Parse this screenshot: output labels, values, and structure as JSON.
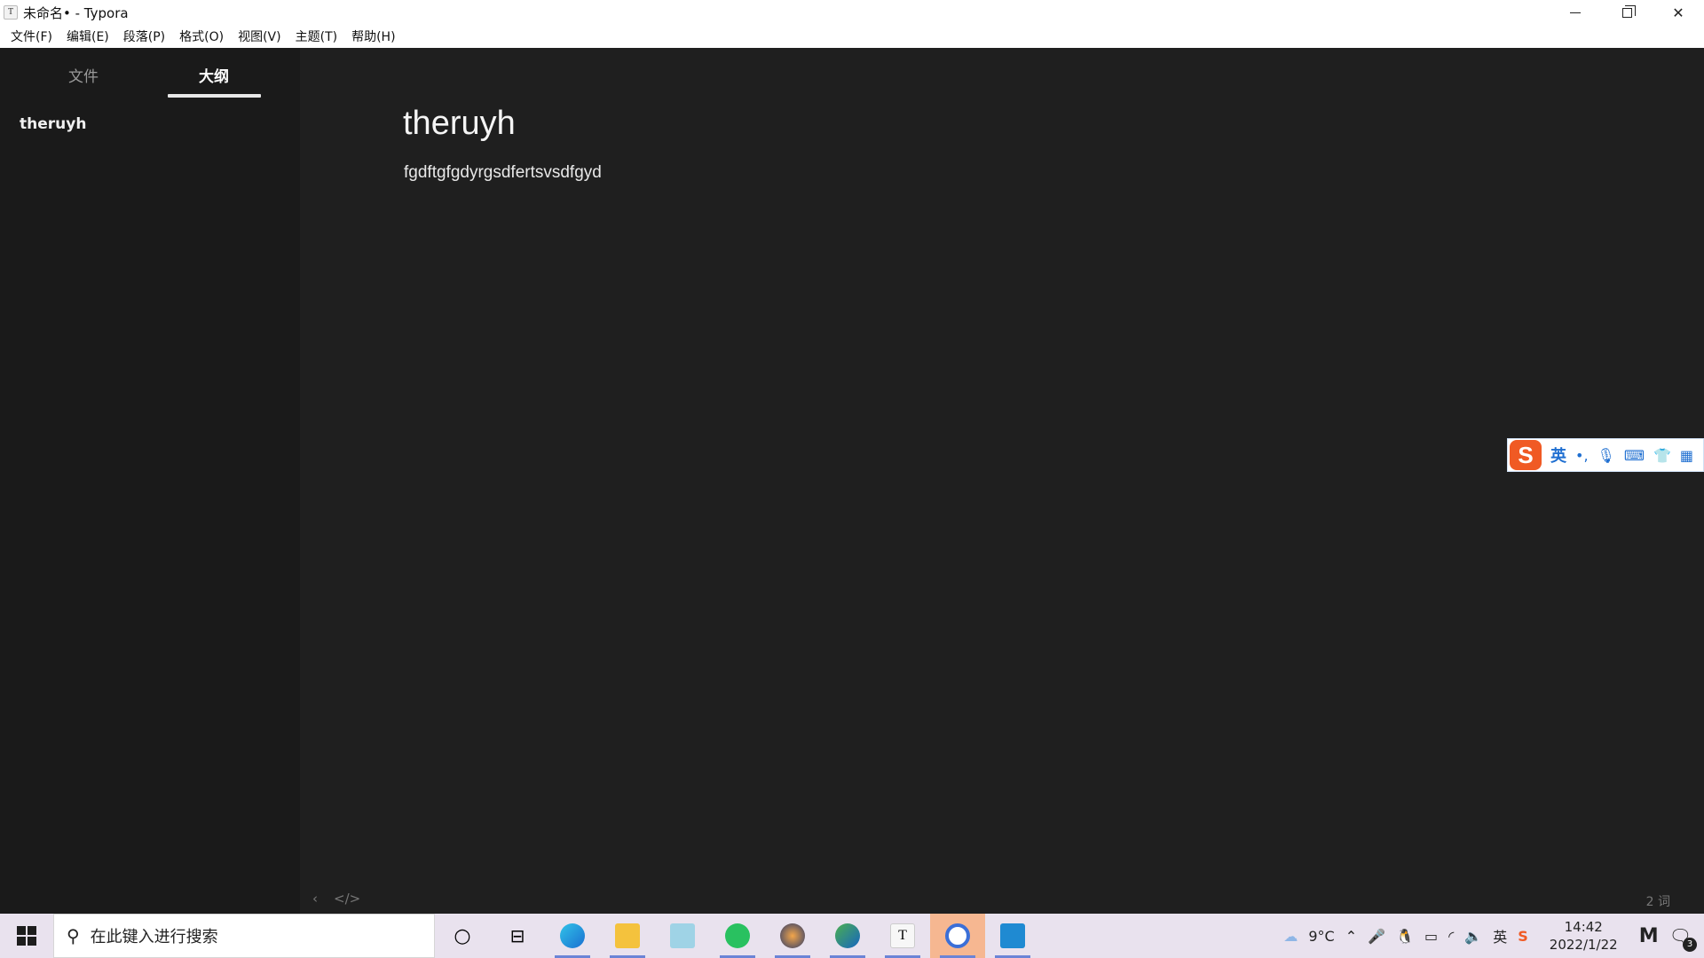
{
  "window": {
    "title": "未命名• - Typora",
    "app_icon_letter": "T"
  },
  "menu": [
    "文件(F)",
    "编辑(E)",
    "段落(P)",
    "格式(O)",
    "视图(V)",
    "主题(T)",
    "帮助(H)"
  ],
  "sidebar": {
    "tabs": [
      "文件",
      "大纲"
    ],
    "active_tab": "大纲",
    "outline_items": [
      "theruyh"
    ]
  },
  "document": {
    "heading": "theruyh",
    "paragraph": "fgdftgfgdyrgsdfertsvsdfgyd"
  },
  "statusbar": {
    "back_icon": "‹",
    "source_icon": "</>",
    "word_count": "2 词"
  },
  "ime": {
    "logo": "S",
    "mode": "英"
  },
  "taskbar": {
    "search_placeholder": "在此键入进行搜索",
    "weather": "9°C",
    "time": "14:42",
    "date": "2022/1/22",
    "notification_count": "3",
    "ms_label": "M"
  }
}
